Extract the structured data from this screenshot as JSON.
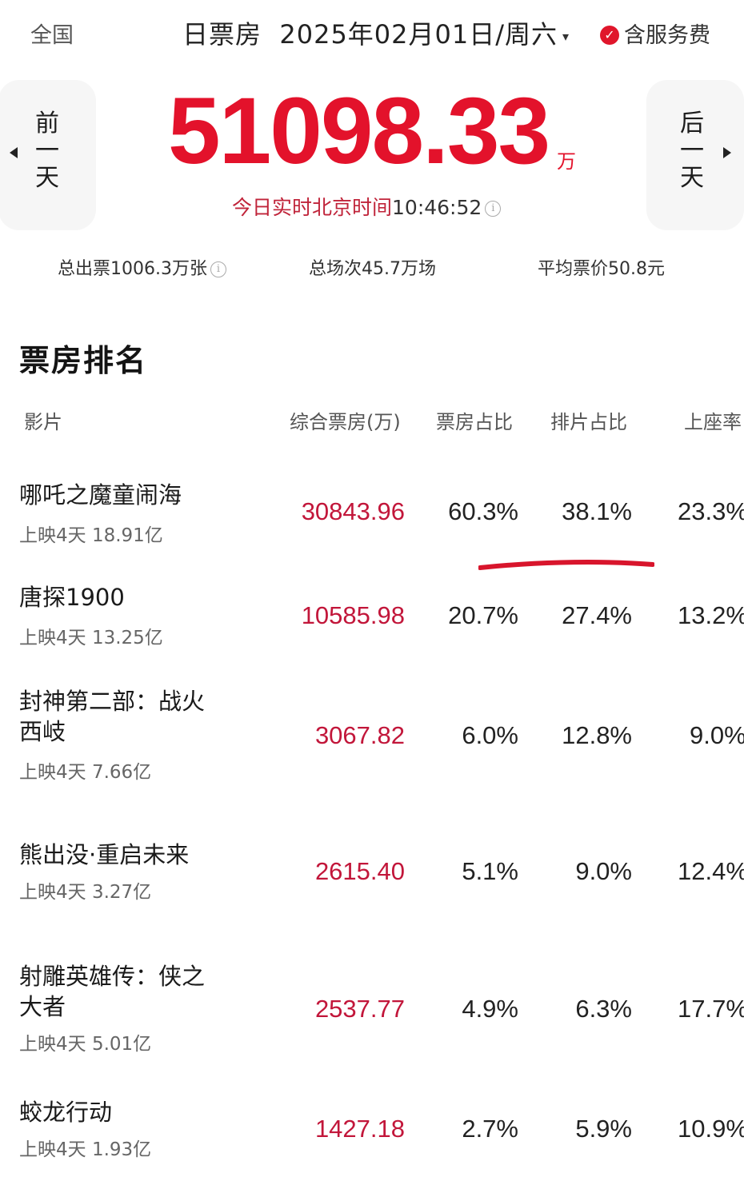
{
  "header": {
    "region": "全国",
    "title": "日票房",
    "date": "2025年02月01日/周六",
    "caret": "▾",
    "service_check": "✓",
    "service_label": "含服务费"
  },
  "nav": {
    "prev_chars": [
      "前",
      "一",
      "天"
    ],
    "next_chars": [
      "后",
      "一",
      "天"
    ]
  },
  "summary": {
    "total_box_office": "51098.33",
    "unit": "万",
    "realtime_label": "今日实时北京时间",
    "realtime_time": "10:46:52",
    "tickets": "总出票1006.3万张",
    "shows": "总场次45.7万场",
    "avg_price": "平均票价50.8元",
    "info_glyph": "i"
  },
  "ranking": {
    "title": "票房排名",
    "columns": {
      "film": "影片",
      "box_office": "综合票房(万)",
      "box_share": "票房占比",
      "show_share": "排片占比",
      "seat_rate": "上座率"
    },
    "rows": [
      {
        "name": "哪吒之魔童闹海",
        "meta": "上映4天 18.91亿",
        "box": "30843.96",
        "box_share": "60.3%",
        "show_share": "38.1%",
        "seat": "23.3%"
      },
      {
        "name": "唐探1900",
        "meta": "上映4天 13.25亿",
        "box": "10585.98",
        "box_share": "20.7%",
        "show_share": "27.4%",
        "seat": "13.2%"
      },
      {
        "name": "封神第二部：战火西岐",
        "meta": "上映4天 7.66亿",
        "box": "3067.82",
        "box_share": "6.0%",
        "show_share": "12.8%",
        "seat": "9.0%"
      },
      {
        "name": "熊出没·重启未来",
        "meta": "上映4天 3.27亿",
        "box": "2615.40",
        "box_share": "5.1%",
        "show_share": "9.0%",
        "seat": "12.4%"
      },
      {
        "name": "射雕英雄传：侠之大者",
        "meta": "上映4天 5.01亿",
        "box": "2537.77",
        "box_share": "4.9%",
        "show_share": "6.3%",
        "seat": "17.7%"
      },
      {
        "name": "蛟龙行动",
        "meta": "上映4天 1.93亿",
        "box": "1427.18",
        "box_share": "2.7%",
        "show_share": "5.9%",
        "seat": "10.9%"
      }
    ]
  },
  "colors": {
    "accent_red": "#e3122b",
    "box_red": "#c2163a",
    "annotation_red": "#d8152c"
  }
}
